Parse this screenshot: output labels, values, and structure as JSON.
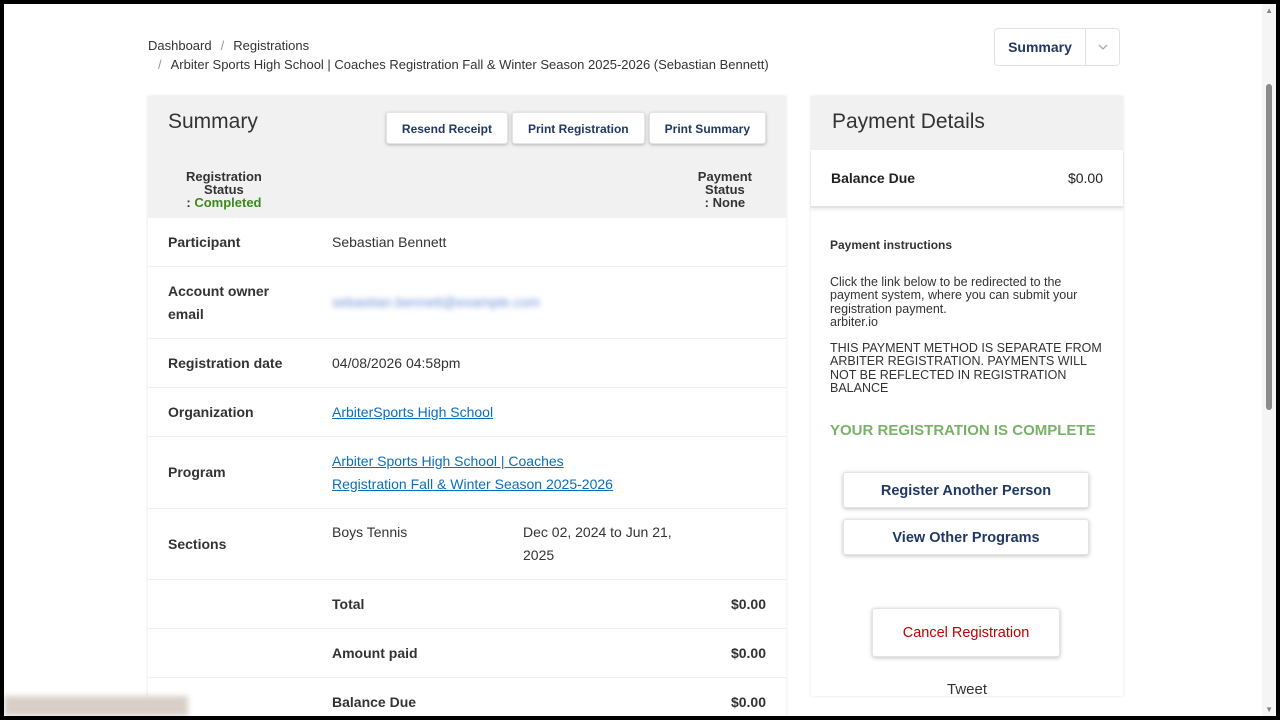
{
  "breadcrumb": {
    "items": [
      "Dashboard",
      "Registrations"
    ],
    "current": "Arbiter Sports High School | Coaches Registration Fall & Winter Season 2025-2026 (Sebastian Bennett)"
  },
  "view_select": {
    "value": "Summary"
  },
  "summary": {
    "title": "Summary",
    "buttons": {
      "resend": "Resend Receipt",
      "print_reg": "Print Registration",
      "print_sum": "Print Summary"
    },
    "reg_status": {
      "line1": "Registration",
      "line2": "Status",
      "prefix": ": ",
      "value": "Completed"
    },
    "pay_status": {
      "line1": "Payment",
      "line2": "Status",
      "line3": ": None"
    },
    "rows": {
      "participant": {
        "label": "Participant",
        "value": "Sebastian Bennett"
      },
      "email": {
        "label1": "Account owner",
        "label2": "email",
        "value": "sebastian.bennett@example.com"
      },
      "reg_date": {
        "label": "Registration date",
        "value": "04/08/2026 04:58pm"
      },
      "organization": {
        "label": "Organization",
        "value": "ArbiterSports High School"
      },
      "program": {
        "label": "Program",
        "line1": "Arbiter Sports High School | Coaches",
        "line2": "Registration Fall & Winter Season 2025-2026"
      },
      "sections": {
        "label": "Sections",
        "name": "Boys Tennis",
        "dates_line1": "Dec 02, 2024 to Jun 21,",
        "dates_line2": "2025"
      }
    },
    "totals": [
      {
        "label": "Total",
        "value": "$0.00"
      },
      {
        "label": "Amount paid",
        "value": "$0.00"
      },
      {
        "label": "Balance Due",
        "value": "$0.00"
      }
    ]
  },
  "payment": {
    "title": "Payment Details",
    "balance_label": "Balance Due",
    "balance_value": "$0.00",
    "instructions_title": "Payment instructions",
    "instructions_p1": "Click the link below to be redirected to the payment system, where you can submit your registration payment.",
    "instructions_link": "arbiter.io",
    "instructions_p2": "THIS PAYMENT METHOD IS SEPARATE FROM ARBITER REGISTRATION. PAYMENTS WILL NOT BE REFLECTED IN REGISTRATION BALANCE",
    "complete_text": "YOUR REGISTRATION IS COMPLETE",
    "register_another": "Register Another Person",
    "view_other": "View Other Programs",
    "cancel": "Cancel Registration",
    "tweet": "Tweet"
  },
  "colors": {
    "accent_navy": "#1f3864",
    "link_blue": "#0b6ebd",
    "completed_green": "#3c8a1e",
    "complete_banner": "#7ab16a",
    "cancel_red": "#c00000"
  }
}
